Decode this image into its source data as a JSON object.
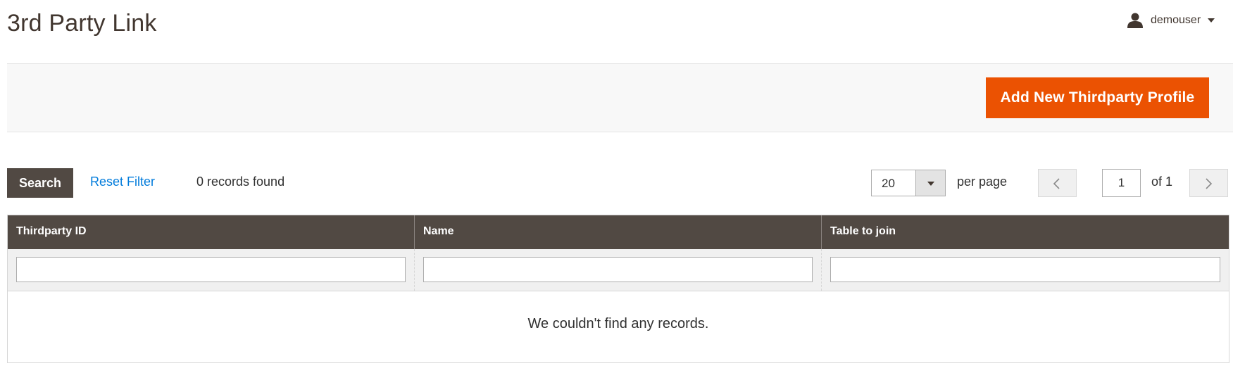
{
  "header": {
    "title": "3rd Party Link",
    "user": {
      "name": "demouser",
      "icon": "user-icon"
    }
  },
  "actions": {
    "add_button_label": "Add New Thirdparty Profile",
    "accent_color": "#eb5202"
  },
  "toolbar": {
    "search_label": "Search",
    "reset_label": "Reset Filter",
    "records_found": "0 records found",
    "per_page": {
      "value": "20",
      "label": "per page"
    },
    "pager": {
      "current_page": "1",
      "total_label": "of 1"
    }
  },
  "grid": {
    "columns": [
      {
        "label": "Thirdparty ID"
      },
      {
        "label": "Name"
      },
      {
        "label": "Table to join"
      }
    ],
    "filters": [
      "",
      "",
      ""
    ],
    "empty_message": "We couldn't find any records.",
    "header_color": "#514943"
  }
}
